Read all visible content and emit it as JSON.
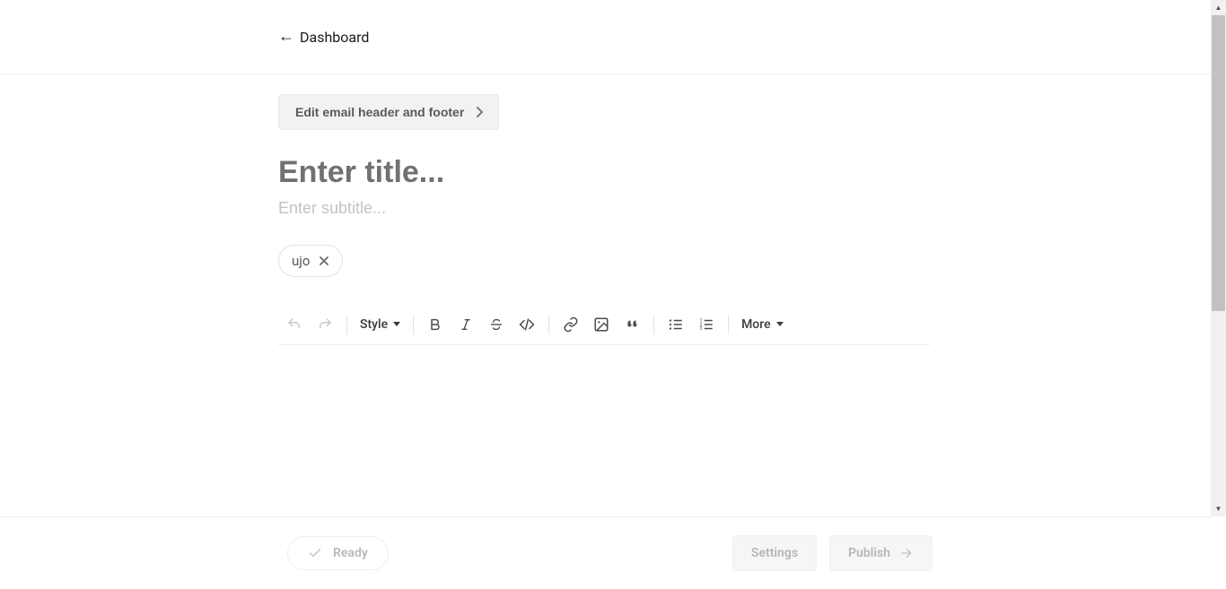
{
  "header": {
    "back_label": "Dashboard"
  },
  "editor": {
    "edit_header_label": "Edit email header and footer",
    "title_placeholder": "Enter title...",
    "subtitle_placeholder": "Enter subtitle...",
    "tags": [
      {
        "label": "ujo"
      }
    ]
  },
  "toolbar": {
    "style_label": "Style",
    "more_label": "More"
  },
  "footer": {
    "ready_label": "Ready",
    "settings_label": "Settings",
    "publish_label": "Publish"
  }
}
